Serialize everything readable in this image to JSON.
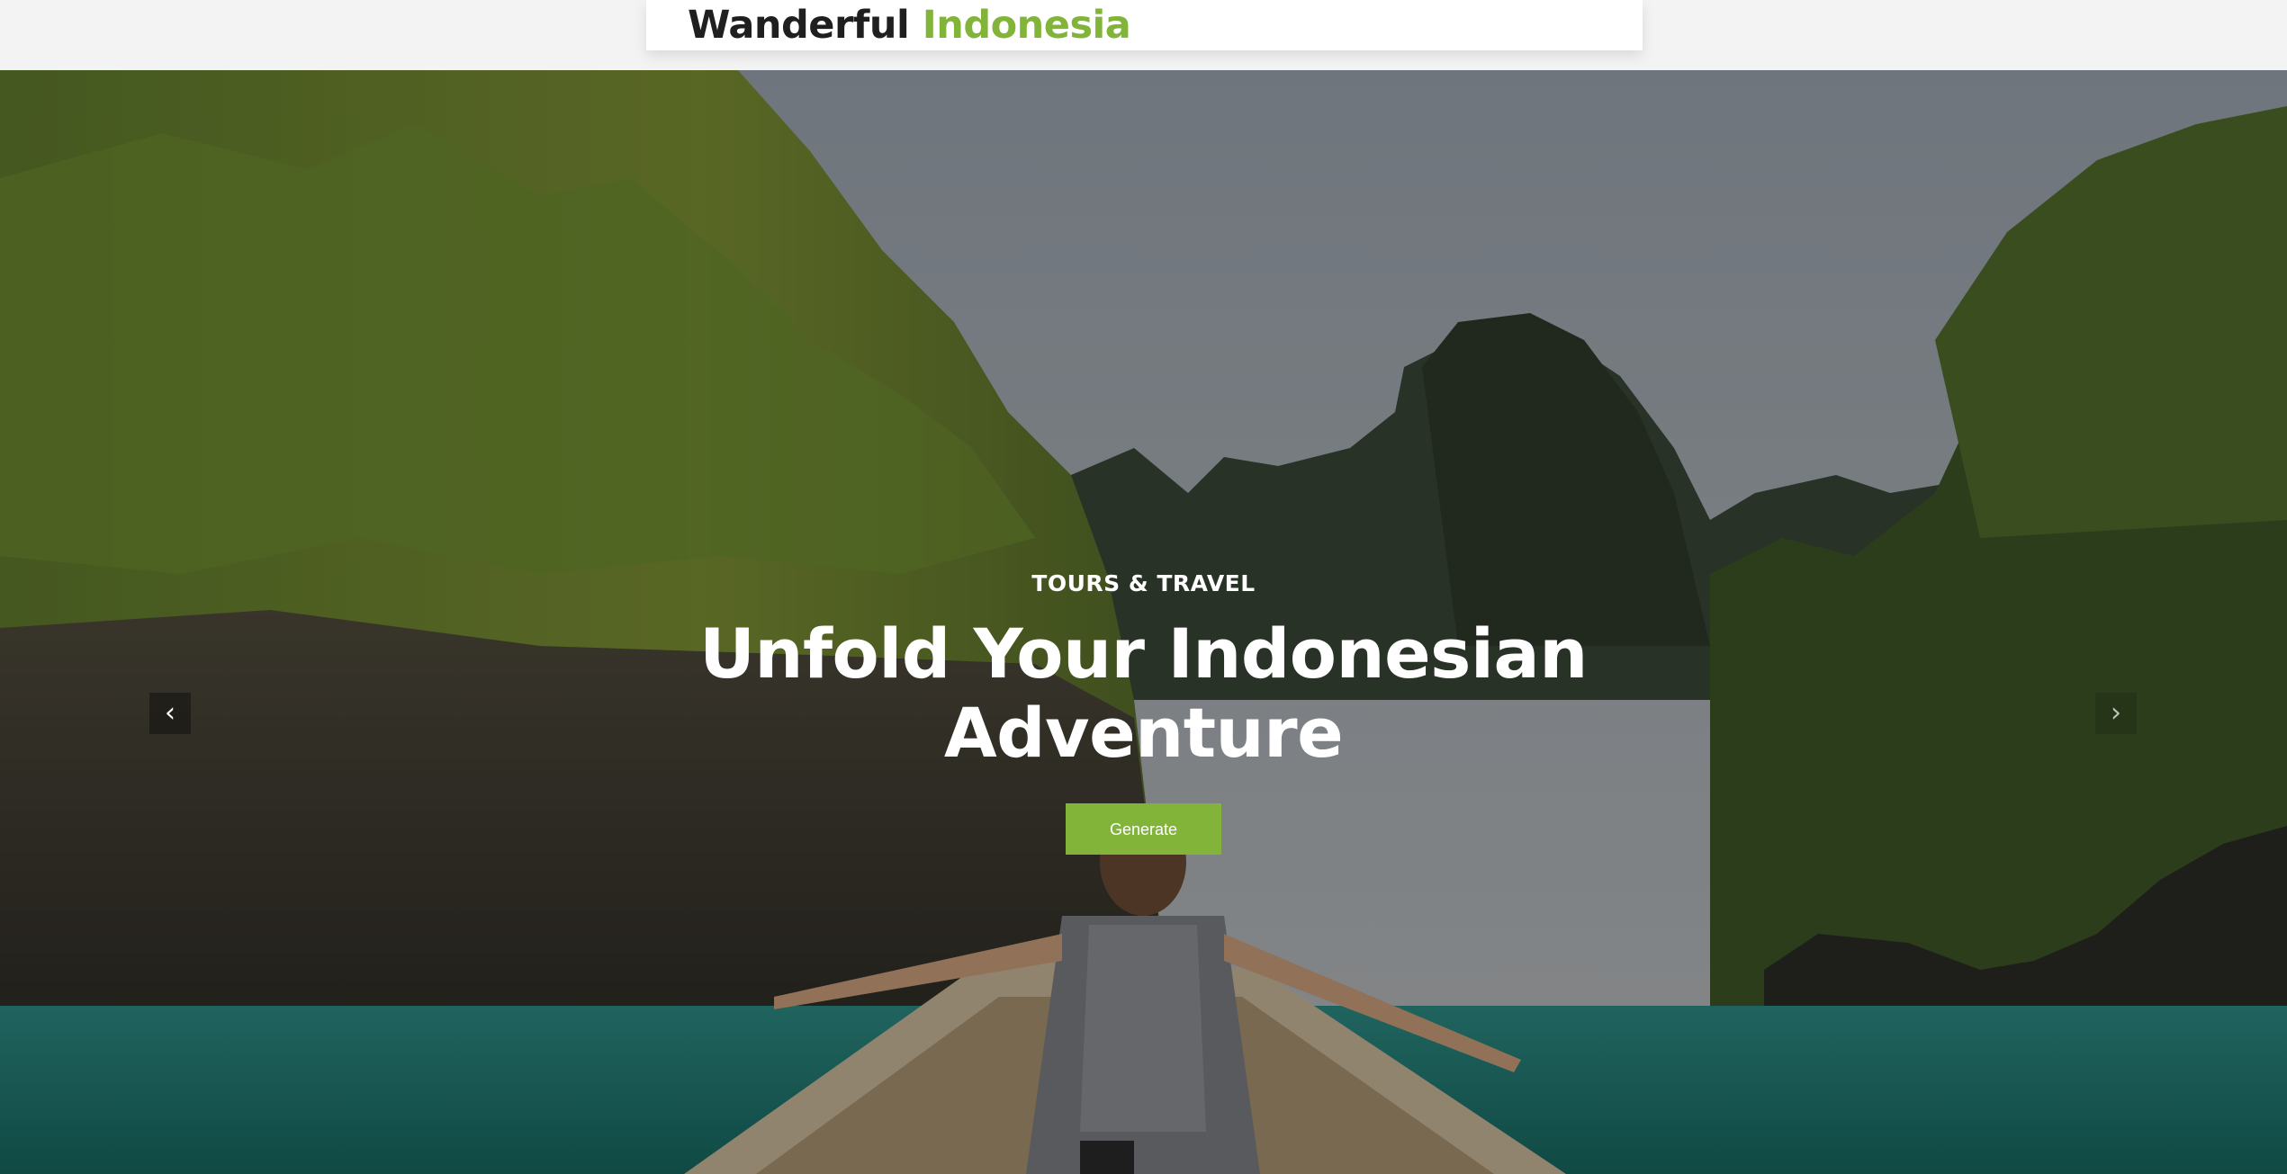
{
  "brand": {
    "word1": "Wanderful",
    "word2": "Indonesia",
    "colors": {
      "dark": "#1f1f1f",
      "accent": "#82b43a"
    }
  },
  "hero": {
    "eyebrow": "TOURS & TRAVEL",
    "headline_line1": "Unfold Your Indonesian",
    "headline_line2": "Adventure",
    "button_label": "Generate",
    "prev_icon": "chevron-left-icon",
    "next_icon": "chevron-right-icon",
    "background": "tropical-lake-photo"
  }
}
